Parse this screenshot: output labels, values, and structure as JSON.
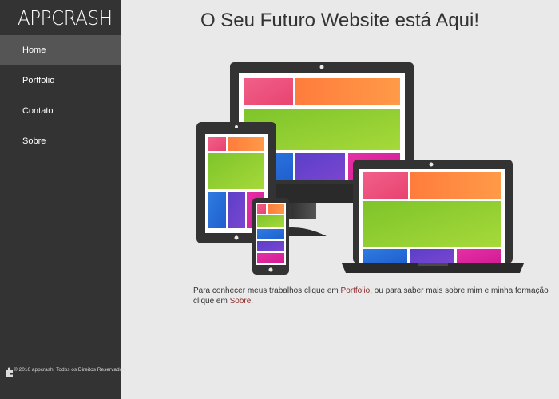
{
  "brand": {
    "logo_text": "APPCRASH"
  },
  "nav": {
    "items": [
      {
        "label": "Home",
        "active": true
      },
      {
        "label": "Portfolio"
      },
      {
        "label": "Contato"
      },
      {
        "label": "Sobre"
      }
    ]
  },
  "footer": {
    "text": "© 2016 appcrash. Todos os Direitos Reservados",
    "icon": "puzzle-icon"
  },
  "main": {
    "headline": "O Seu Futuro Website está Aqui!",
    "intro": {
      "part1": "Para conhecer meus trabalhos clique em ",
      "link1": "Portfolio",
      "part2": ", ou para saber mais sobre mim e minha formação clique em ",
      "link2": "Sobre",
      "part3": "."
    }
  },
  "colors": {
    "sidebar_bg": "#333333",
    "active_item_bg": "#555555",
    "page_bg": "#e9e9e9",
    "link": "#8b2b2b"
  }
}
